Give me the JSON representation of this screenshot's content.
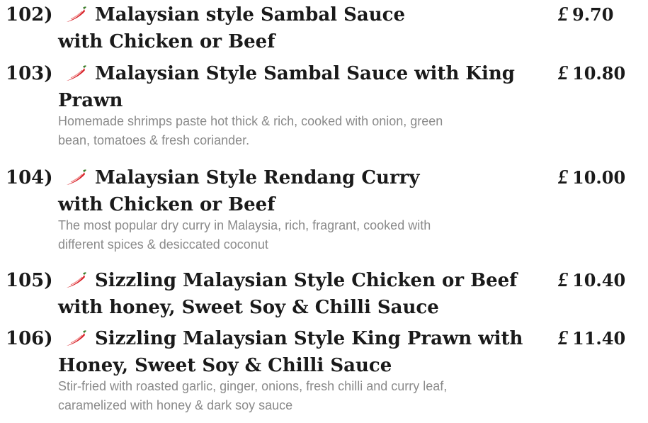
{
  "currency_symbol": "£",
  "items": [
    {
      "number": "102)",
      "title_line1": "Malaysian style Sambal Sauce",
      "title_line2": "with Chicken or Beef",
      "price": "9.70",
      "spicy_icon": "chili-pepper-icon",
      "description_line1": "",
      "description_line2": ""
    },
    {
      "number": "103)",
      "title_line1": "Malaysian Style Sambal Sauce with King",
      "title_line2": "Prawn",
      "price": "10.80",
      "spicy_icon": "chili-pepper-icon",
      "description_line1": "Homemade shrimps paste hot thick & rich, cooked with onion, green",
      "description_line2": "bean, tomatoes & fresh coriander."
    },
    {
      "number": "104)",
      "title_line1": "Malaysian Style Rendang Curry",
      "title_line2": "with Chicken or Beef",
      "price": "10.00",
      "spicy_icon": "chili-pepper-icon",
      "description_line1": "The most popular dry curry in Malaysia, rich, fragrant, cooked with",
      "description_line2": "different spices & desiccated coconut"
    },
    {
      "number": "105)",
      "title_line1": "Sizzling Malaysian Style Chicken or Beef",
      "title_line2": "with honey, Sweet Soy & Chilli Sauce",
      "price": "10.40",
      "spicy_icon": "chili-pepper-icon",
      "description_line1": "",
      "description_line2": ""
    },
    {
      "number": "106)",
      "title_line1": "Sizzling Malaysian Style King Prawn with",
      "title_line2": "Honey, Sweet  Soy & Chilli Sauce",
      "price": "11.40",
      "spicy_icon": "chili-pepper-icon",
      "description_line1": "Stir-fried with roasted garlic, ginger, onions, fresh chilli and curry leaf,",
      "description_line2": "caramelized with honey & dark soy sauce"
    }
  ],
  "colors": {
    "title": "#1a1a1a",
    "description": "#8a8a8a",
    "chili": "#d8232a"
  }
}
